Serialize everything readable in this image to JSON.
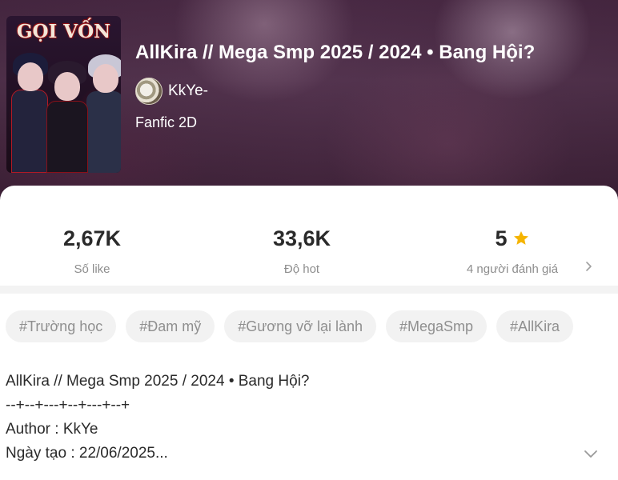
{
  "story": {
    "cover_title": "GỌI VỐN",
    "title": "AllKira // Mega Smp 2025 / 2024 • Bang Hội?",
    "author": "KkYe-",
    "genre": "Fanfic 2D"
  },
  "stats": {
    "likes": {
      "value": "2,67K",
      "label": "Số like"
    },
    "hot": {
      "value": "33,6K",
      "label": "Độ hot"
    },
    "rating": {
      "value": "5",
      "label": "4 người đánh giá",
      "icon": "star-icon"
    }
  },
  "tags": [
    "#Trường học",
    "#Đam mỹ",
    "#Gương vỡ lại lành",
    "#MegaSmp",
    "#AllKira"
  ],
  "description": {
    "lines": [
      "AllKira // Mega Smp 2025 / 2024 • Bang Hội?",
      "--+--+---+--+---+--+",
      "Author : KkYe",
      "Ngày tạo : 22/06/2025..."
    ],
    "expand_icon": "chevron-down-icon"
  },
  "colors": {
    "hero_bg": "#4a2a45",
    "star": "#f5b400",
    "tag_bg": "#f2f2f2",
    "tag_text": "#8f8f8f"
  }
}
